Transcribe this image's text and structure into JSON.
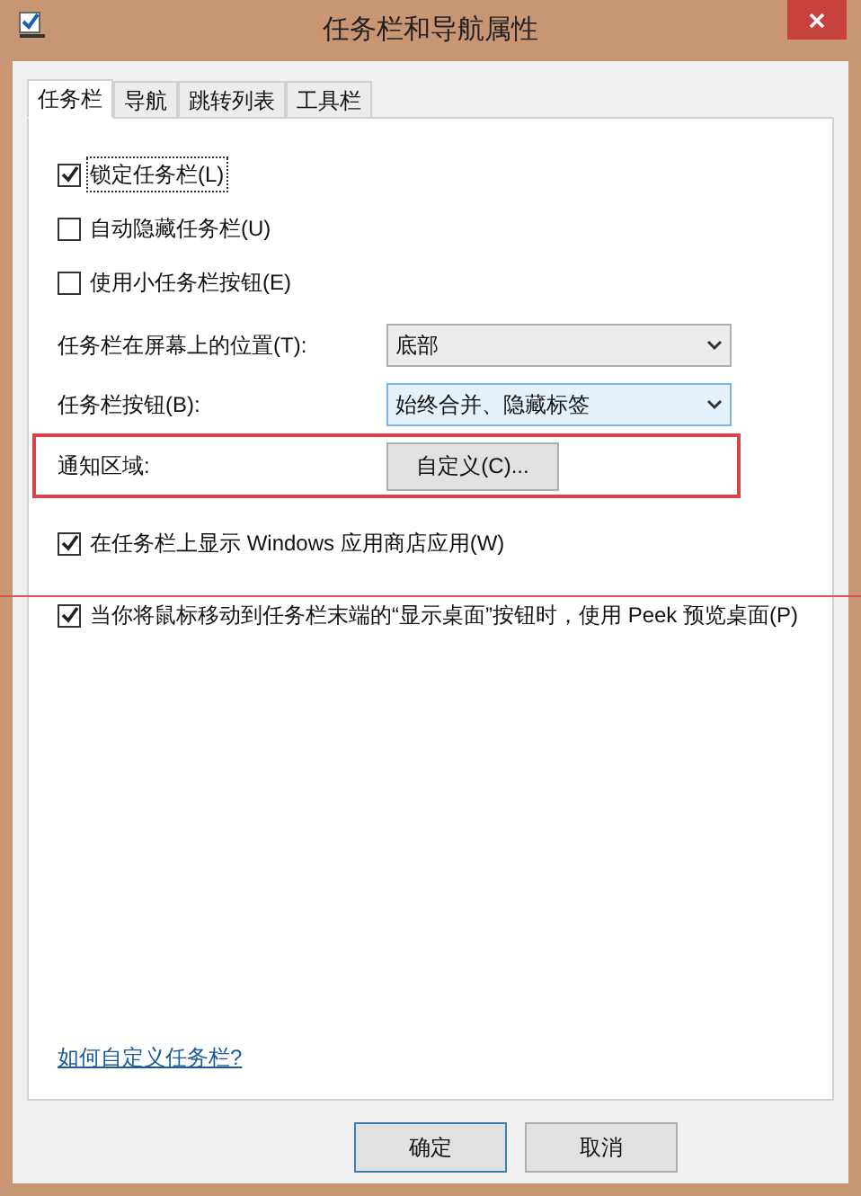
{
  "window": {
    "title": "任务栏和导航属性"
  },
  "tabs": [
    {
      "label": "任务栏",
      "selected": true
    },
    {
      "label": "导航",
      "selected": false
    },
    {
      "label": "跳转列表",
      "selected": false
    },
    {
      "label": "工具栏",
      "selected": false
    }
  ],
  "settings": [
    {
      "kind": "checkbox",
      "label": "锁定任务栏(L)",
      "checked": true,
      "focused": true
    },
    {
      "kind": "checkbox",
      "label": "自动隐藏任务栏(U)",
      "checked": false,
      "focused": false
    },
    {
      "kind": "checkbox",
      "label": "使用小任务栏按钮(E)",
      "checked": false,
      "focused": false
    },
    {
      "kind": "select",
      "label": "任务栏在屏幕上的位置(T):",
      "value": "底部",
      "hovered": false
    },
    {
      "kind": "select",
      "label": "任务栏按钮(B):",
      "value": "始终合并、隐藏标签",
      "hovered": true
    },
    {
      "kind": "button",
      "label": "通知区域:",
      "button": "自定义(C)...",
      "highlighted": true
    },
    {
      "kind": "checkbox",
      "label": "在任务栏上显示 Windows 应用商店应用(W)",
      "checked": true,
      "focused": false
    },
    {
      "kind": "checkbox",
      "label": "当你将鼠标移动到任务栏末端的“显示桌面”按钮时，使用 Peek 预览桌面(P)",
      "checked": true,
      "focused": false
    }
  ],
  "help_link": "如何自定义任务栏?",
  "buttons": [
    {
      "label": "确定",
      "default": true
    },
    {
      "label": "取消",
      "default": false
    }
  ]
}
